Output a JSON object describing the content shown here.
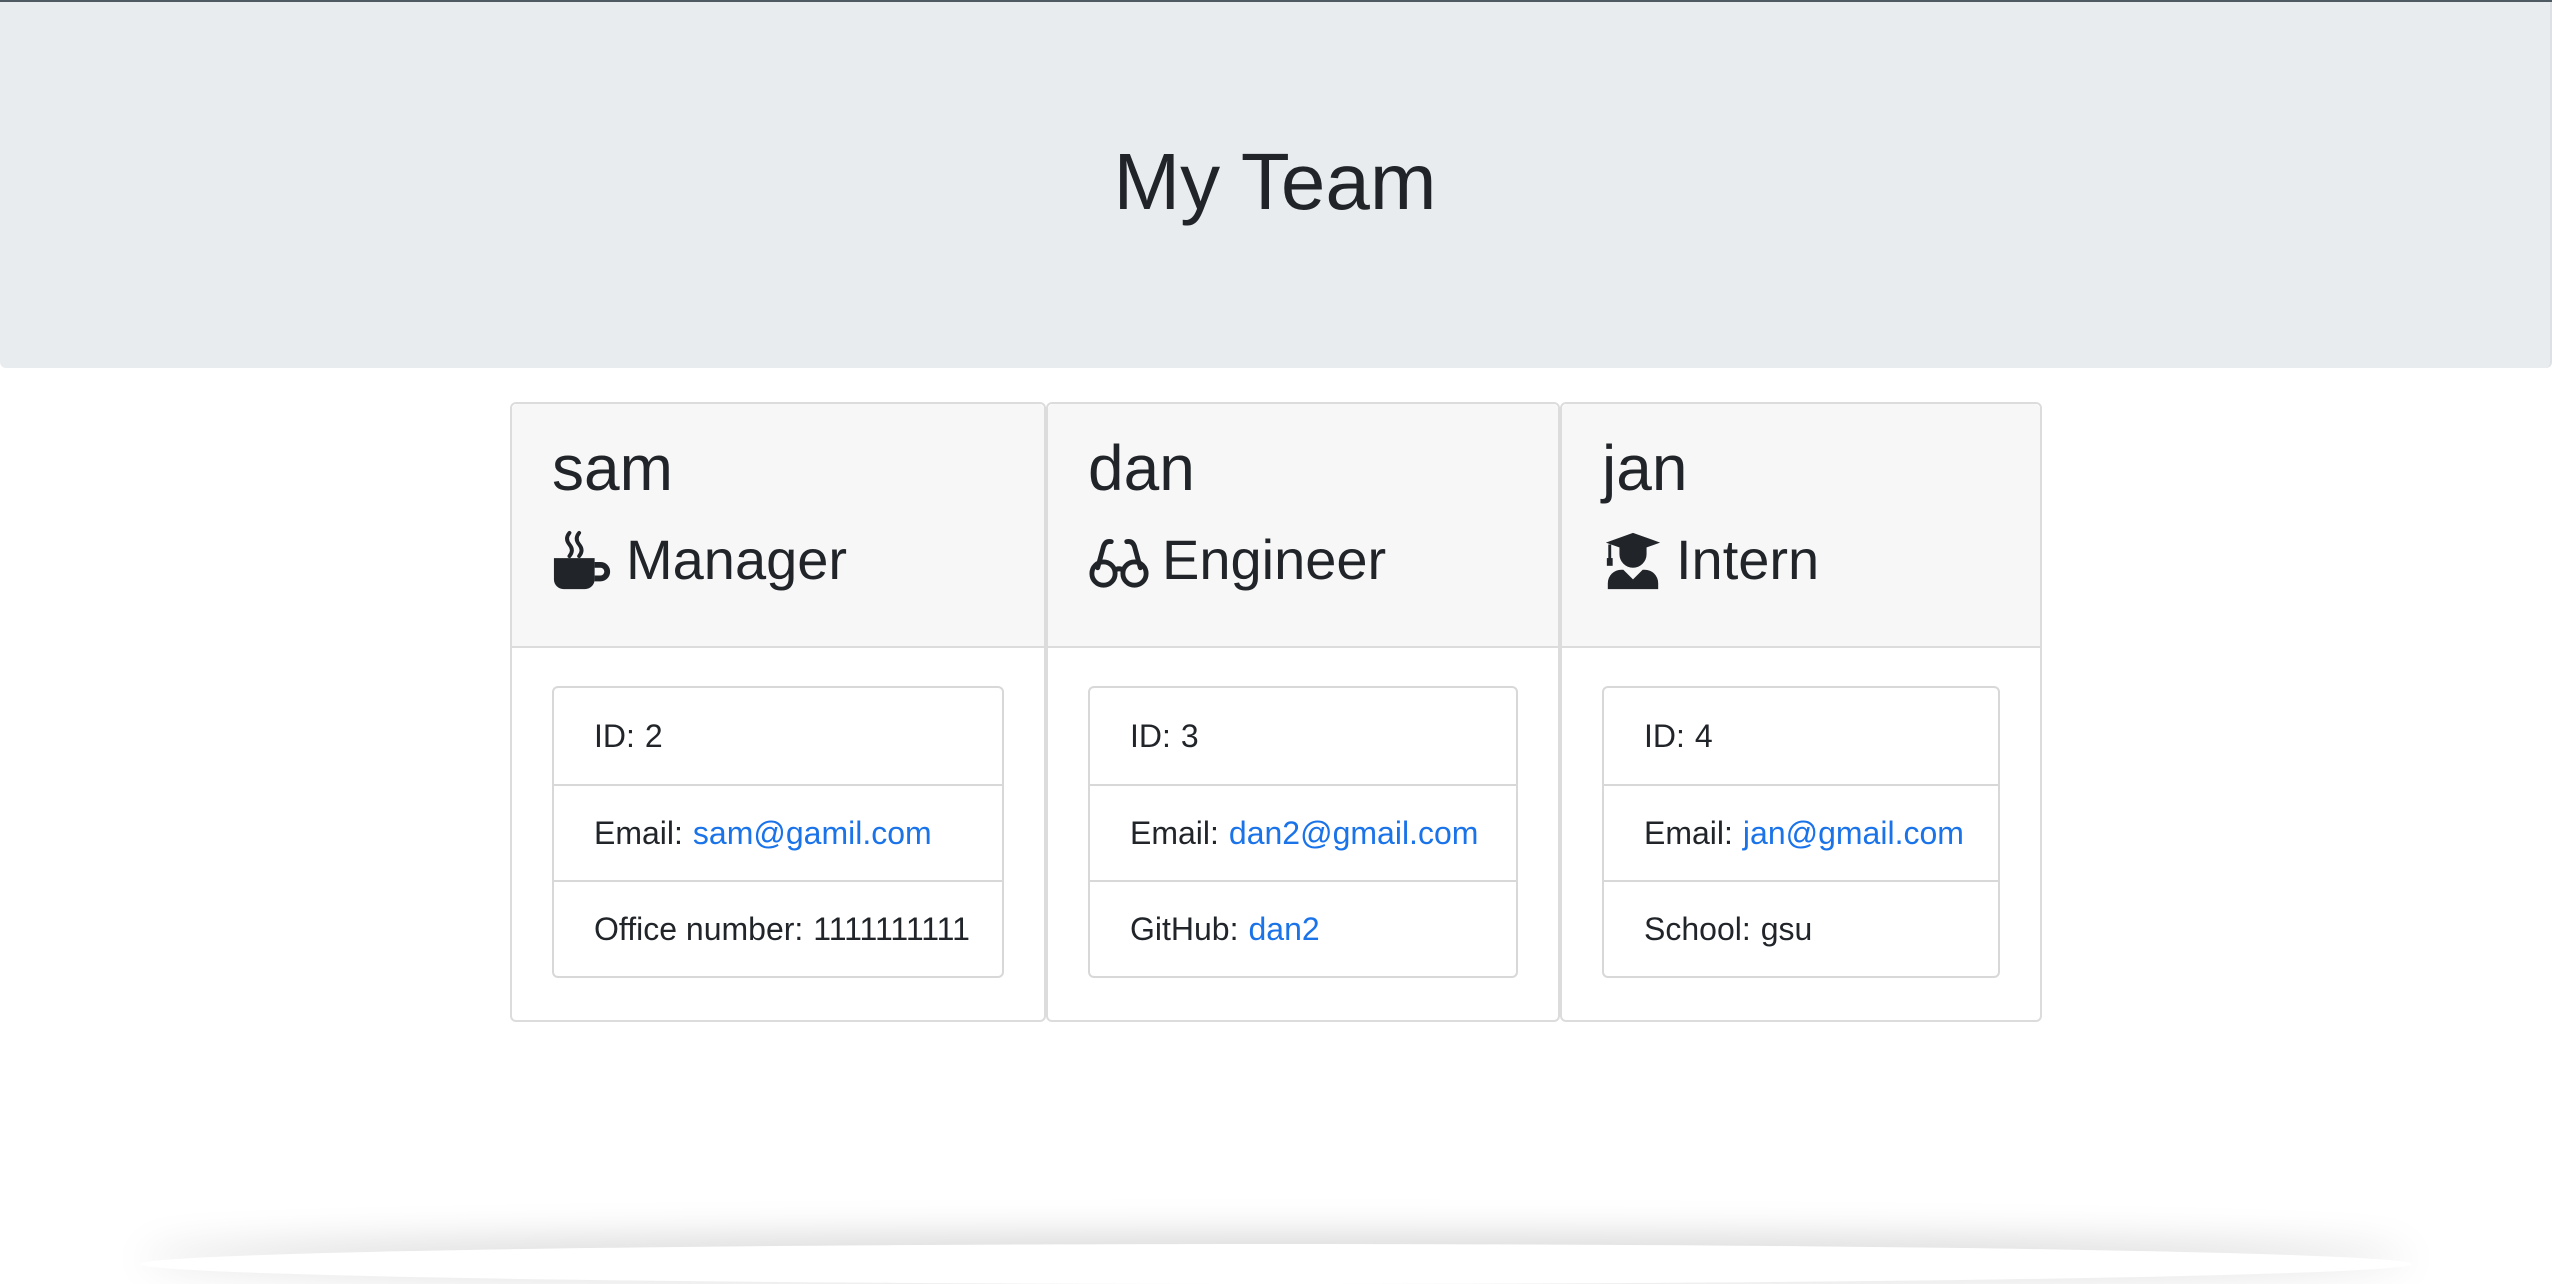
{
  "header": {
    "title": "My Team"
  },
  "team": [
    {
      "name": "sam",
      "role": "Manager",
      "role_icon": "mug-icon",
      "id_label": "ID:",
      "id": "2",
      "email_label": "Email:",
      "email": "sam@gamil.com",
      "extra_label": "Office number:",
      "extra": "1111111111"
    },
    {
      "name": "dan",
      "role": "Engineer",
      "role_icon": "glasses-icon",
      "id_label": "ID:",
      "id": "3",
      "email_label": "Email:",
      "email": "dan2@gmail.com",
      "extra_label": "GitHub:",
      "extra": "dan2"
    },
    {
      "name": "jan",
      "role": "Intern",
      "role_icon": "graduate-icon",
      "id_label": "ID:",
      "id": "4",
      "email_label": "Email:",
      "email": "jan@gmail.com",
      "extra_label": "School:",
      "extra": "gsu"
    }
  ],
  "colors": {
    "link": "#1a73e8",
    "jumbotron": "#e9ecef",
    "card_header": "#f7f7f7"
  }
}
